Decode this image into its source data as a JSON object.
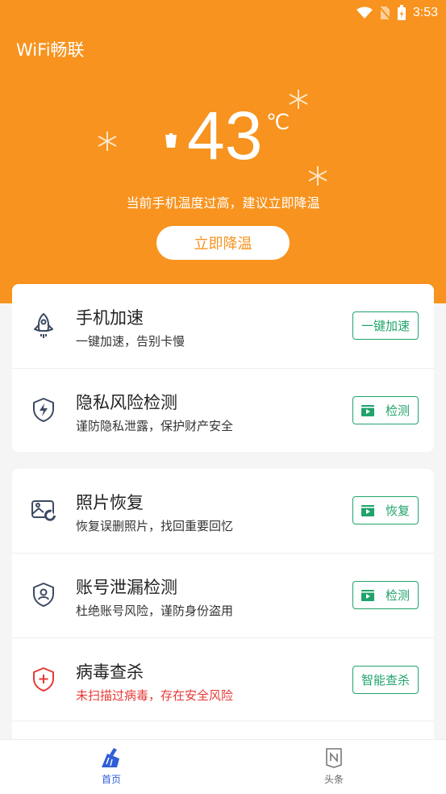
{
  "status": {
    "time": "3:53"
  },
  "app": {
    "title": "WiFi畅联"
  },
  "temperature": {
    "value": "43",
    "unit": "℃",
    "warning": "当前手机温度过高，建议立即降温",
    "button": "立即降温"
  },
  "features_top": [
    {
      "title": "手机加速",
      "subtitle": "一键加速，告别卡慢",
      "button": "一键加速",
      "icon": "rocket-icon"
    },
    {
      "title": "隐私风险检测",
      "subtitle": "谨防隐私泄露，保护财产安全",
      "button": "检测",
      "icon": "shield-bolt-icon"
    }
  ],
  "features_bottom": [
    {
      "title": "照片恢复",
      "subtitle": "恢复误删照片，找回重要回忆",
      "button": "恢复",
      "icon": "photo-recover-icon"
    },
    {
      "title": "账号泄漏检测",
      "subtitle": "杜绝账号风险，谨防身份盗用",
      "button": "检测",
      "icon": "shield-user-icon"
    },
    {
      "title": "病毒查杀",
      "subtitle": "未扫描过病毒，存在安全风险",
      "button": "智能查杀",
      "icon": "shield-plus-icon"
    }
  ],
  "tabs": {
    "home": "首页",
    "news": "头条"
  },
  "colors": {
    "header": "#f7931e",
    "accent_green": "#21a36b",
    "danger": "#e53935",
    "tab_active": "#2f5fd6"
  }
}
